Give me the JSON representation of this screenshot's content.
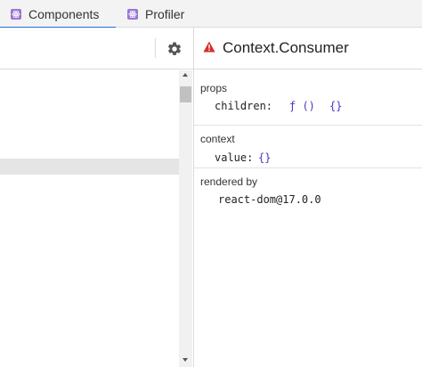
{
  "tabs": [
    {
      "label": "Components",
      "active": true
    },
    {
      "label": "Profiler",
      "active": false
    }
  ],
  "settings": {
    "icon": "gear-icon"
  },
  "inspector": {
    "component_name": "Context.Consumer",
    "warning_icon": "warning-icon",
    "props": {
      "title": "props",
      "key": "children:",
      "value_func": "ƒ ()",
      "value_obj": "{}"
    },
    "context": {
      "title": "context",
      "key": "value:",
      "value": "{}"
    },
    "rendered_by": {
      "title": "rendered by",
      "value": "react-dom@17.0.0"
    }
  },
  "colors": {
    "accent": "#1e6fd9",
    "react_icon": "#9a76d4",
    "warning": "#d32f2f",
    "value": "#4b36c7"
  }
}
